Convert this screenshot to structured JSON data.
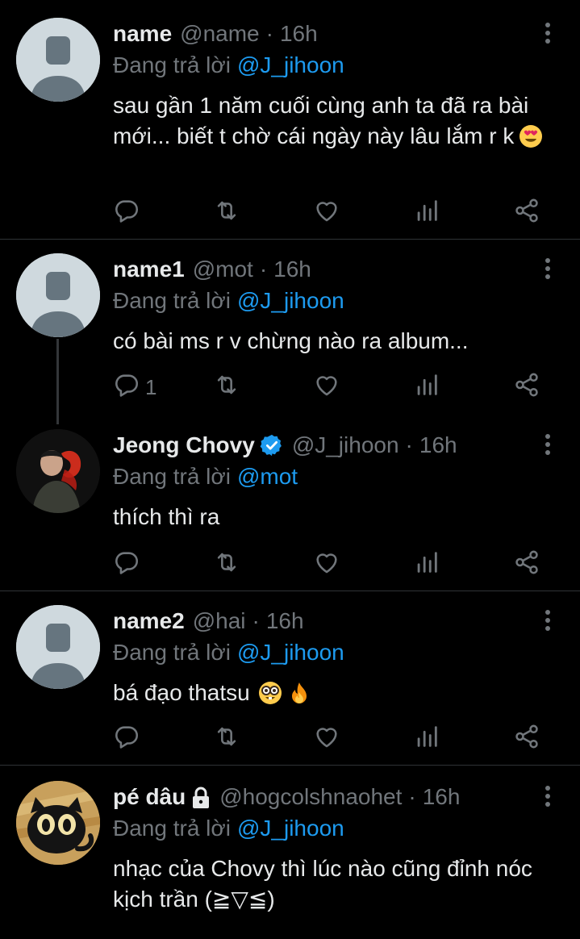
{
  "colors": {
    "background": "#000000",
    "text": "#e7e9ea",
    "muted": "#71767b",
    "link": "#1d9bf0",
    "divider": "#2f3336",
    "verified": "#1d9bf0"
  },
  "tweets": [
    {
      "display_name": "name",
      "handle": "@name",
      "separator": "·",
      "time": "16h",
      "replying_prefix": "Đang trả lời",
      "replying_to": "@J_jihoon",
      "text": "sau gần 1 năm cuối cùng anh ta đã ra bài mới... biết t chờ cái ngày này lâu lắm r k",
      "emoji": "smiling-face-with-heart-eyes",
      "avatar": "default-avatar",
      "reply_count": ""
    },
    {
      "display_name": "name1",
      "handle": "@mot",
      "separator": "·",
      "time": "16h",
      "replying_prefix": "Đang trả lời",
      "replying_to": "@J_jihoon",
      "text": "có bài ms r v chừng nào ra album...",
      "avatar": "default-avatar",
      "reply_count": "1"
    },
    {
      "display_name": "Jeong Chovy",
      "handle": "@J_jihoon",
      "separator": "·",
      "time": "16h",
      "replying_prefix": "Đang trả lời",
      "replying_to": "@mot",
      "text": "thích thì ra",
      "avatar": "photo-avatar",
      "verified": true,
      "reply_count": ""
    },
    {
      "display_name": "name2",
      "handle": "@hai",
      "separator": "·",
      "time": "16h",
      "replying_prefix": "Đang trả lời",
      "replying_to": "@J_jihoon",
      "text": "bá đạo thatsu",
      "emoji": [
        "nerd-face",
        "fire"
      ],
      "avatar": "default-avatar",
      "reply_count": ""
    },
    {
      "display_name": "pé dâu",
      "handle": "@hogcolshnaohet",
      "separator": "·",
      "time": "16h",
      "replying_prefix": "Đang trả lời",
      "replying_to": "@J_jihoon",
      "text": "nhạc của Chovy thì lúc nào cũng đỉnh nóc kịch trần (≧▽≦)",
      "avatar": "cat-avatar",
      "protected": true,
      "reply_count": ""
    }
  ],
  "action_icons": [
    "reply-icon",
    "retweet-icon",
    "like-icon",
    "views-icon",
    "share-icon"
  ]
}
